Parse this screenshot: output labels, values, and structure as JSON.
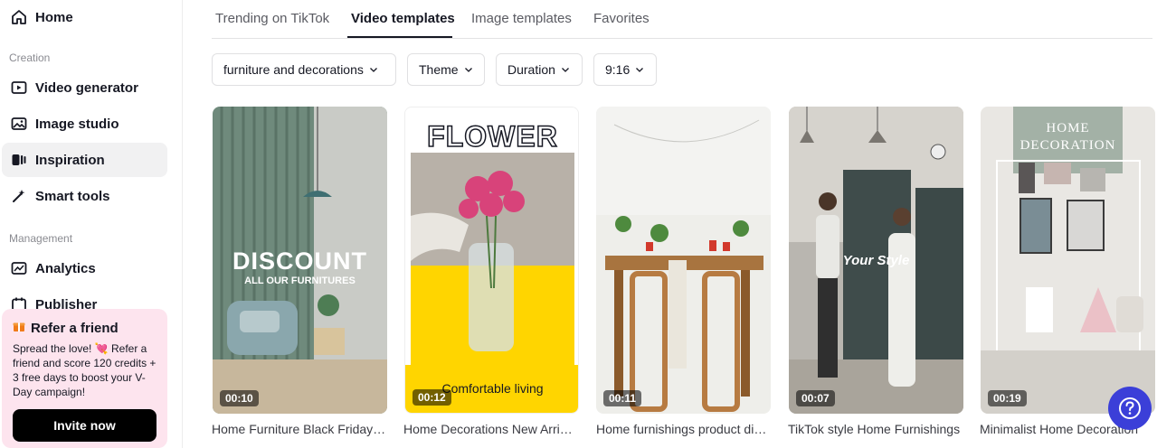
{
  "sidebar": {
    "home": "Home",
    "creation_label": "Creation",
    "video_generator": "Video generator",
    "image_studio": "Image studio",
    "inspiration": "Inspiration",
    "smart_tools": "Smart tools",
    "management_label": "Management",
    "analytics": "Analytics",
    "publisher": "Publisher"
  },
  "refer": {
    "title": "Refer a friend",
    "text": "Spread the love! 💘 Refer a friend and score 120 credits + 3 free days to boost your V-Day campaign!",
    "button": "Invite now"
  },
  "tabs": [
    "Trending on TikTok",
    "Video templates",
    "Image templates",
    "Favorites"
  ],
  "filters": [
    "furniture and decorations",
    "Theme",
    "Duration",
    "9:16"
  ],
  "cards": [
    {
      "duration": "00:10",
      "title": "Home Furniture Black Friday Sale",
      "overlay": "DISCOUNT",
      "overlay_sub": "ALL OUR FURNITURES"
    },
    {
      "duration": "00:12",
      "title": "Home Decorations New Arrivals",
      "overlay": "FLOWER",
      "overlay_sub": "Comfortable living"
    },
    {
      "duration": "00:11",
      "title": "Home furnishings product display"
    },
    {
      "duration": "00:07",
      "title": "TikTok style Home Furnishings",
      "overlay": "Your Style"
    },
    {
      "duration": "00:19",
      "title": "Minimalist Home Decoration",
      "overlay": "HOME",
      "overlay_sub": "DECORATION"
    }
  ],
  "colors": {
    "accent": "#3b3fd8",
    "refer_bg": "#fde4ee",
    "active_nav": "#f1f1f2"
  }
}
